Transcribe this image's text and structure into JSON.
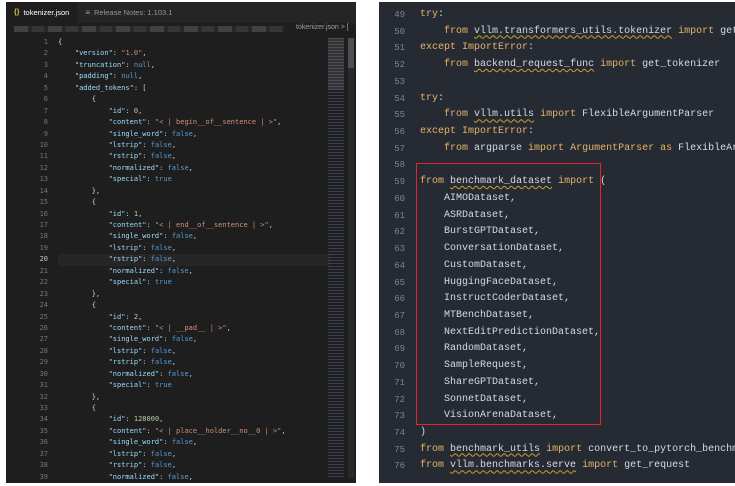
{
  "left_editor": {
    "tabs": [
      {
        "icon": "{}",
        "label": "tokenizer.json",
        "active": true
      },
      {
        "icon": "≡",
        "label": "Release Notes: 1.103.1",
        "active": false
      }
    ],
    "breadcrumb_tail": "tokenizer.json > [",
    "current_line": 20,
    "lines": [
      {
        "n": "1",
        "html": "<span class='p'>{</span>"
      },
      {
        "n": "2",
        "html": "    <span class='k'>\"version\"</span><span class='p'>: </span><span class='s'>\"1.0\"</span><span class='p'>,</span>"
      },
      {
        "n": "3",
        "html": "    <span class='k'>\"truncation\"</span><span class='p'>: </span><span class='kw'>null</span><span class='p'>,</span>"
      },
      {
        "n": "4",
        "html": "    <span class='k'>\"padding\"</span><span class='p'>: </span><span class='kw'>null</span><span class='p'>,</span>"
      },
      {
        "n": "5",
        "html": "    <span class='k'>\"added_tokens\"</span><span class='p'>: [</span>"
      },
      {
        "n": "6",
        "html": "        <span class='p'>{</span>"
      },
      {
        "n": "7",
        "html": "            <span class='k'>\"id\"</span><span class='p'>: </span><span class='n'>0</span><span class='p'>,</span>"
      },
      {
        "n": "8",
        "html": "            <span class='k'>\"content\"</span><span class='p'>: </span><span class='s'>\"&lt; | begin__of__sentence | &gt;\"</span><span class='p'>,</span>"
      },
      {
        "n": "9",
        "html": "            <span class='k'>\"single_word\"</span><span class='p'>: </span><span class='kw'>false</span><span class='p'>,</span>"
      },
      {
        "n": "10",
        "html": "            <span class='k'>\"lstrip\"</span><span class='p'>: </span><span class='kw'>false</span><span class='p'>,</span>"
      },
      {
        "n": "11",
        "html": "            <span class='k'>\"rstrip\"</span><span class='p'>: </span><span class='kw'>false</span><span class='p'>,</span>"
      },
      {
        "n": "12",
        "html": "            <span class='k'>\"normalized\"</span><span class='p'>: </span><span class='kw'>false</span><span class='p'>,</span>"
      },
      {
        "n": "13",
        "html": "            <span class='k'>\"special\"</span><span class='p'>: </span><span class='kw'>true</span>"
      },
      {
        "n": "14",
        "html": "        <span class='p'>},</span>"
      },
      {
        "n": "15",
        "html": "        <span class='p'>{</span>"
      },
      {
        "n": "16",
        "html": "            <span class='k'>\"id\"</span><span class='p'>: </span><span class='n'>1</span><span class='p'>,</span>"
      },
      {
        "n": "17",
        "html": "            <span class='k'>\"content\"</span><span class='p'>: </span><span class='s'>\"&lt; | end__of__sentence | &gt;\"</span><span class='p'>,</span>"
      },
      {
        "n": "18",
        "html": "            <span class='k'>\"single_word\"</span><span class='p'>: </span><span class='kw'>false</span><span class='p'>,</span>"
      },
      {
        "n": "19",
        "html": "            <span class='k'>\"lstrip\"</span><span class='p'>: </span><span class='kw'>false</span><span class='p'>,</span>"
      },
      {
        "n": "20",
        "html": "            <span class='k'>\"rstrip\"</span><span class='p'>: </span><span class='kw'>false</span><span class='p'>,</span>"
      },
      {
        "n": "21",
        "html": "            <span class='k'>\"normalized\"</span><span class='p'>: </span><span class='kw'>false</span><span class='p'>,</span>"
      },
      {
        "n": "22",
        "html": "            <span class='k'>\"special\"</span><span class='p'>: </span><span class='kw'>true</span>"
      },
      {
        "n": "23",
        "html": "        <span class='p'>},</span>"
      },
      {
        "n": "24",
        "html": "        <span class='p'>{</span>"
      },
      {
        "n": "25",
        "html": "            <span class='k'>\"id\"</span><span class='p'>: </span><span class='n'>2</span><span class='p'>,</span>"
      },
      {
        "n": "26",
        "html": "            <span class='k'>\"content\"</span><span class='p'>: </span><span class='s'>\"&lt; | __pad__ | &gt;\"</span><span class='p'>,</span>"
      },
      {
        "n": "27",
        "html": "            <span class='k'>\"single_word\"</span><span class='p'>: </span><span class='kw'>false</span><span class='p'>,</span>"
      },
      {
        "n": "28",
        "html": "            <span class='k'>\"lstrip\"</span><span class='p'>: </span><span class='kw'>false</span><span class='p'>,</span>"
      },
      {
        "n": "29",
        "html": "            <span class='k'>\"rstrip\"</span><span class='p'>: </span><span class='kw'>false</span><span class='p'>,</span>"
      },
      {
        "n": "30",
        "html": "            <span class='k'>\"normalized\"</span><span class='p'>: </span><span class='kw'>false</span><span class='p'>,</span>"
      },
      {
        "n": "31",
        "html": "            <span class='k'>\"special\"</span><span class='p'>: </span><span class='kw'>true</span>"
      },
      {
        "n": "32",
        "html": "        <span class='p'>},</span>"
      },
      {
        "n": "33",
        "html": "        <span class='p'>{</span>"
      },
      {
        "n": "34",
        "html": "            <span class='k'>\"id\"</span><span class='p'>: </span><span class='n'>128000</span><span class='p'>,</span>"
      },
      {
        "n": "35",
        "html": "            <span class='k'>\"content\"</span><span class='p'>: </span><span class='s'>\"&lt; | place__holder__no__0 | &gt;\"</span><span class='p'>,</span>"
      },
      {
        "n": "36",
        "html": "            <span class='k'>\"single_word\"</span><span class='p'>: </span><span class='kw'>false</span><span class='p'>,</span>"
      },
      {
        "n": "37",
        "html": "            <span class='k'>\"lstrip\"</span><span class='p'>: </span><span class='kw'>false</span><span class='p'>,</span>"
      },
      {
        "n": "38",
        "html": "            <span class='k'>\"rstrip\"</span><span class='p'>: </span><span class='kw'>false</span><span class='p'>,</span>"
      },
      {
        "n": "39",
        "html": "            <span class='k'>\"normalized\"</span><span class='p'>: </span><span class='kw'>false</span><span class='p'>,</span>"
      }
    ]
  },
  "right_editor": {
    "lines": [
      {
        "n": "49",
        "html": "<span class='pkw'>try</span>:"
      },
      {
        "n": "50",
        "html": "    <span class='pkw'>from</span> <span class='wavy'>vllm.transformers_utils.tokenizer</span> <span class='pkw'>import</span> get_tokenizer"
      },
      {
        "n": "51",
        "html": "<span class='pkw'>except</span> <span class='pcls'>ImportError</span>:"
      },
      {
        "n": "52",
        "html": "    <span class='pkw'>from</span> <span class='wavy'>backend_request_func</span> <span class='pkw'>import</span> get_tokenizer"
      },
      {
        "n": "53",
        "html": ""
      },
      {
        "n": "54",
        "html": "<span class='pkw'>try</span>:"
      },
      {
        "n": "55",
        "html": "    <span class='pkw'>from</span> <span class='wavy'>vllm.utils</span> <span class='pkw'>import</span> FlexibleArgumentParser"
      },
      {
        "n": "56",
        "html": "<span class='pkw'>except</span> <span class='pcls'>ImportError</span>:"
      },
      {
        "n": "57",
        "html": "    <span class='pkw'>from</span> argparse <span class='pkw'>import</span> <span class='pcls'>ArgumentParser</span> <span class='pkw'>as</span> FlexibleArgumentParser"
      },
      {
        "n": "58",
        "html": ""
      },
      {
        "n": "59",
        "html": "<span class='pkw'>from</span> <span class='wavy'>benchmark_dataset</span> <span class='pkw'>import</span> ("
      },
      {
        "n": "60",
        "html": "    AIMODataset,"
      },
      {
        "n": "61",
        "html": "    ASRDataset,"
      },
      {
        "n": "62",
        "html": "    BurstGPTDataset,"
      },
      {
        "n": "63",
        "html": "    ConversationDataset,"
      },
      {
        "n": "64",
        "html": "    CustomDataset,"
      },
      {
        "n": "65",
        "html": "    HuggingFaceDataset,"
      },
      {
        "n": "66",
        "html": "    InstructCoderDataset,"
      },
      {
        "n": "67",
        "html": "    MTBenchDataset,"
      },
      {
        "n": "68",
        "html": "    NextEditPredictionDataset,"
      },
      {
        "n": "69",
        "html": "    RandomDataset,"
      },
      {
        "n": "70",
        "html": "    SampleRequest,"
      },
      {
        "n": "71",
        "html": "    ShareGPTDataset,"
      },
      {
        "n": "72",
        "html": "    SonnetDataset,"
      },
      {
        "n": "73",
        "html": "    VisionArenaDataset,"
      },
      {
        "n": "74",
        "html": ")"
      },
      {
        "n": "75",
        "html": "<span class='pkw'>from</span> <span class='wavy'>benchmark_utils</span> <span class='pkw'>import</span> convert_to_pytorch_benchmark_format, w"
      },
      {
        "n": "76",
        "html": "<span class='pkw'>from</span> <span class='wavy'>vllm.benchmarks.serve</span> <span class='pkw'>import</span> get_request"
      }
    ]
  },
  "colors": {
    "highlight_box": "#e0262b",
    "left_bg": "#1e1e1e",
    "right_bg": "#262a33"
  }
}
